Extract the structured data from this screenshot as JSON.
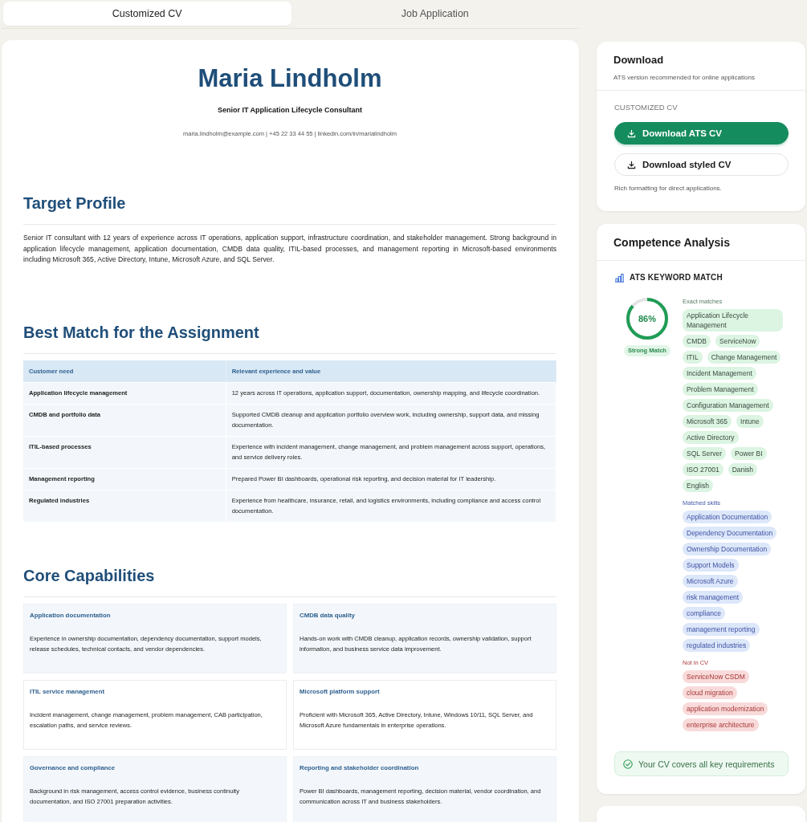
{
  "tabs": [
    {
      "label": "Customized CV",
      "selected": true
    },
    {
      "label": "Job Application",
      "selected": false
    }
  ],
  "cv": {
    "name": "Maria Lindholm",
    "title": "Senior IT Application Lifecycle Consultant",
    "contact": "maria.lindholm@example.com | +45 22 33 44 55 | linkedin.com/in/marialindholm",
    "sections": [
      {
        "kind": "text",
        "heading": "Target Profile",
        "text": "Senior IT consultant with 12 years of experience across IT operations, application support, infrastructure coordination, and stakeholder management. Strong background in application lifecycle management, application documentation, CMDB data quality, ITIL-based processes, and management reporting in Microsoft-based environments including Microsoft 365, Active Directory, Intune, Microsoft Azure, and SQL Server."
      },
      {
        "kind": "table",
        "heading": "Best Match for the Assignment",
        "columns": [
          "Customer need",
          "Relevant experience and value"
        ],
        "rows": [
          [
            "Application lifecycle management",
            "12 years across IT operations, application support, documentation, ownership mapping, and lifecycle coordination."
          ],
          [
            "CMDB and portfolio data",
            "Supported CMDB cleanup and application portfolio overview work, including ownership, support data, and missing documentation."
          ],
          [
            "ITIL-based processes",
            "Experience with incident management, change management, and problem management across support, operations, and service delivery roles."
          ],
          [
            "Management reporting",
            "Prepared Power BI dashboards, operational risk reporting, and decision material for IT leadership."
          ],
          [
            "Regulated industries",
            "Experience from healthcare, insurance, retail, and logistics environments, including compliance and access control documentation."
          ]
        ]
      },
      {
        "kind": "cards",
        "heading": "Core Capabilities",
        "cards": [
          {
            "title": "Application documentation",
            "text": "Experience in ownership documentation, dependency documentation, support models, release schedules, technical contacts, and vendor dependencies."
          },
          {
            "title": "CMDB data quality",
            "text": "Hands-on work with CMDB cleanup, application records, ownership validation, support information, and business service data improvement."
          },
          {
            "title": "ITIL service management",
            "text": "Incident management, change management, problem management, CAB participation, escalation paths, and service reviews."
          },
          {
            "title": "Microsoft platform support",
            "text": "Proficient with Microsoft 365, Active Directory, Intune, Windows 10/11, SQL Server, and Microsoft Azure fundamentals in enterprise operations."
          },
          {
            "title": "Governance and compliance",
            "text": "Background in risk management, access control evidence, business continuity documentation, and ISO 27001 preparation activities."
          },
          {
            "title": "Reporting and stakeholder coordination",
            "text": "Power BI dashboards, management reporting, decision material, vendor coordination, and communication across IT and business stakeholders."
          }
        ]
      }
    ]
  },
  "download": {
    "title": "Download",
    "subtitle": "ATS version recommended for online applications",
    "section_label": "CUSTOMIZED CV",
    "buttons": [
      {
        "label": "Download ATS CV",
        "kind": "primary"
      },
      {
        "label": "Download styled CV",
        "kind": "secondary"
      }
    ],
    "note": "Rich formatting for direct applications."
  },
  "competence": {
    "title": "Competence Analysis",
    "keyword_heading": "ATS KEYWORD MATCH",
    "score": {
      "text": "86%",
      "level": 0.86,
      "label": "Strong Match"
    },
    "groups": [
      {
        "kind": "exact",
        "label": "Exact matches",
        "tags": [
          "Application Lifecycle Management",
          "CMDB",
          "ServiceNow",
          "ITIL",
          "Change Management",
          "Incident Management",
          "Problem Management",
          "Configuration Management",
          "Microsoft 365",
          "Intune",
          "Active Directory",
          "SQL Server",
          "Power BI",
          "ISO 27001",
          "Danish",
          "English"
        ]
      },
      {
        "kind": "matched",
        "label": "Matched skills",
        "tags": [
          "Application Documentation",
          "Dependency Documentation",
          "Ownership Documentation",
          "Support Models",
          "Microsoft Azure",
          "risk management",
          "compliance",
          "management reporting",
          "regulated industries"
        ]
      },
      {
        "kind": "missing",
        "label": "Not in CV",
        "tags": [
          "ServiceNow CSDM",
          "cloud migration",
          "application modernization",
          "enterprise architecture"
        ]
      }
    ],
    "summary": "Your CV covers all key requirements"
  }
}
